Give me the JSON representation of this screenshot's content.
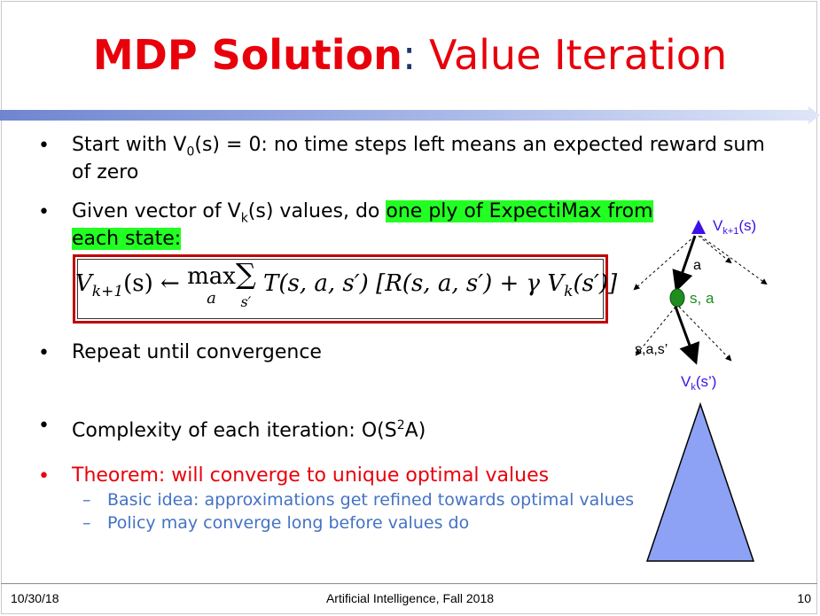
{
  "title": {
    "bold": "MDP Solution",
    "colon": ":",
    "rest": " Value Iteration"
  },
  "bullets": {
    "b1_pre": "Start with V",
    "b1_sub": "0",
    "b1_post": "(s) = 0: no time steps left means an expected reward sum",
    "b1_line2": "of zero",
    "b2_pre": "Given vector of V",
    "b2_sub": "k",
    "b2_mid": "(s) values, do ",
    "b2_hl1": "one ply of ExpectiMax from",
    "b2_hl2": " each state:",
    "b3": "Repeat until convergence",
    "b4_pre": "Complexity of each iteration: O(S",
    "b4_sup": "2",
    "b4_post": "A)",
    "b5": "Theorem: will converge to unique optimal values",
    "sub1": "Basic idea: approximations get refined towards optimal values",
    "sub2": "Policy may converge long before values do",
    "bullet_char": "•",
    "dash_char": "–"
  },
  "equation": {
    "lhs": "V",
    "lhs_sub": "k+1",
    "lhs_arg": "(s) ←",
    "max": "max",
    "max_sub": "a",
    "sum": "∑",
    "sum_sub": "s′",
    "body": "T(s, a, s′) [R(s, a, s′) + γ V",
    "body_sub": "k",
    "body_end": "(s′)]"
  },
  "diagram": {
    "top_label_pre": "V",
    "top_label_sub": "k+1",
    "top_label_post": "(s)",
    "a_label": "a",
    "chance_label": "s, a",
    "sas_label": "s,a,s’",
    "bottom_label_pre": "V",
    "bottom_label_sub": "k",
    "bottom_label_post": "(s’)"
  },
  "footer": {
    "date": "10/30/18",
    "course": "Artificial Intelligence, Fall 2018",
    "page": "10"
  },
  "colors": {
    "red": "#e8000b",
    "blue_text": "#4472c4",
    "highlight": "#22ff22",
    "triangle": "#8da2f4",
    "node_top": "#3d10e8",
    "node_chance": "#1e8c1e"
  }
}
